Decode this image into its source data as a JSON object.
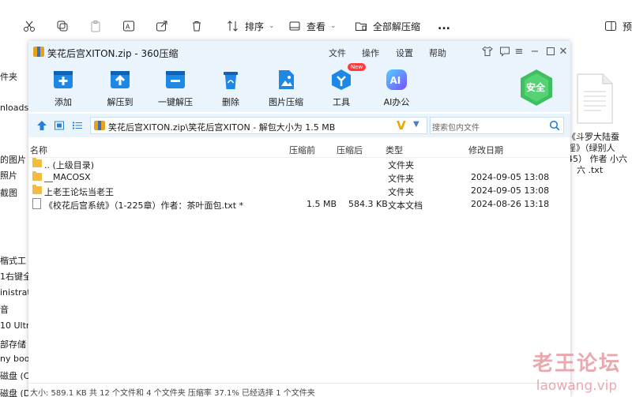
{
  "explorer": {
    "toolbar": {
      "sort_label": "排序",
      "view_label": "查看",
      "extract_all_label": "全部解压缩",
      "more_label": "...",
      "preview_label": "预"
    },
    "sidebar_items": [
      "件夹",
      "nloads",
      "的图片",
      "照片",
      "截图",
      "楷式工",
      "1右键全",
      "inistrat",
      "音",
      "10 Ultra",
      "部存储",
      "ny boo",
      "磁盘 (C",
      "磁盘 (D"
    ],
    "right_file_caption": [
      "《斗罗大陆蚕",
      "淫》（绿别人",
      "45） 作者 小六",
      "六 .txt"
    ]
  },
  "watermark": {
    "line1": "老王论坛",
    "line2": "laowang.vip"
  },
  "window": {
    "title": "笑花后宫XITON.zip - 360压缩",
    "menu": [
      "文件",
      "操作",
      "设置",
      "帮助"
    ],
    "toolbar": [
      {
        "label": "添加",
        "icon": "add-icon"
      },
      {
        "label": "解压到",
        "icon": "extract-to-icon"
      },
      {
        "label": "一键解压",
        "icon": "one-click-extract-icon"
      },
      {
        "label": "删除",
        "icon": "delete-icon"
      },
      {
        "label": "图片压缩",
        "icon": "image-compress-icon"
      },
      {
        "label": "工具",
        "icon": "tools-icon"
      },
      {
        "label": "AI办公",
        "icon": "ai-office-icon"
      }
    ],
    "tools_badge": "New",
    "safe_label": "安全",
    "path": "笑花后宫XITON.zip\\笑花后宫XITON - 解包大小为 1.5 MB",
    "search_placeholder": "搜索包内文件",
    "columns": [
      "名称",
      "压缩前",
      "压缩后",
      "类型",
      "修改日期"
    ],
    "rows": [
      {
        "name": ".. (上级目录)",
        "before": "",
        "after": "",
        "type": "文件夹",
        "date": "",
        "icon": "folder"
      },
      {
        "name": "__MACOSX",
        "before": "",
        "after": "",
        "type": "文件夹",
        "date": "2024-09-05 13:08",
        "icon": "folder"
      },
      {
        "name": "上老王论坛当老王",
        "before": "",
        "after": "",
        "type": "文件夹",
        "date": "2024-09-05 13:08",
        "icon": "folder"
      },
      {
        "name": "《校花后宫系统》（1-225章）作者：茶叶面包.txt *",
        "before": "1.5 MB",
        "after": "584.3 KB",
        "type": "文本文档",
        "date": "2024-08-26 13:18",
        "icon": "txt"
      }
    ],
    "status": "大小: 589.1 KB 共 12 个文件和 4 个文件夹 压缩率 37.1% 已经选择 1 个文件夹",
    "colors": {
      "accent": "#1f88e5",
      "chrome_bg": "#e9f4fd",
      "safe_green": "#3fbf5f"
    }
  }
}
